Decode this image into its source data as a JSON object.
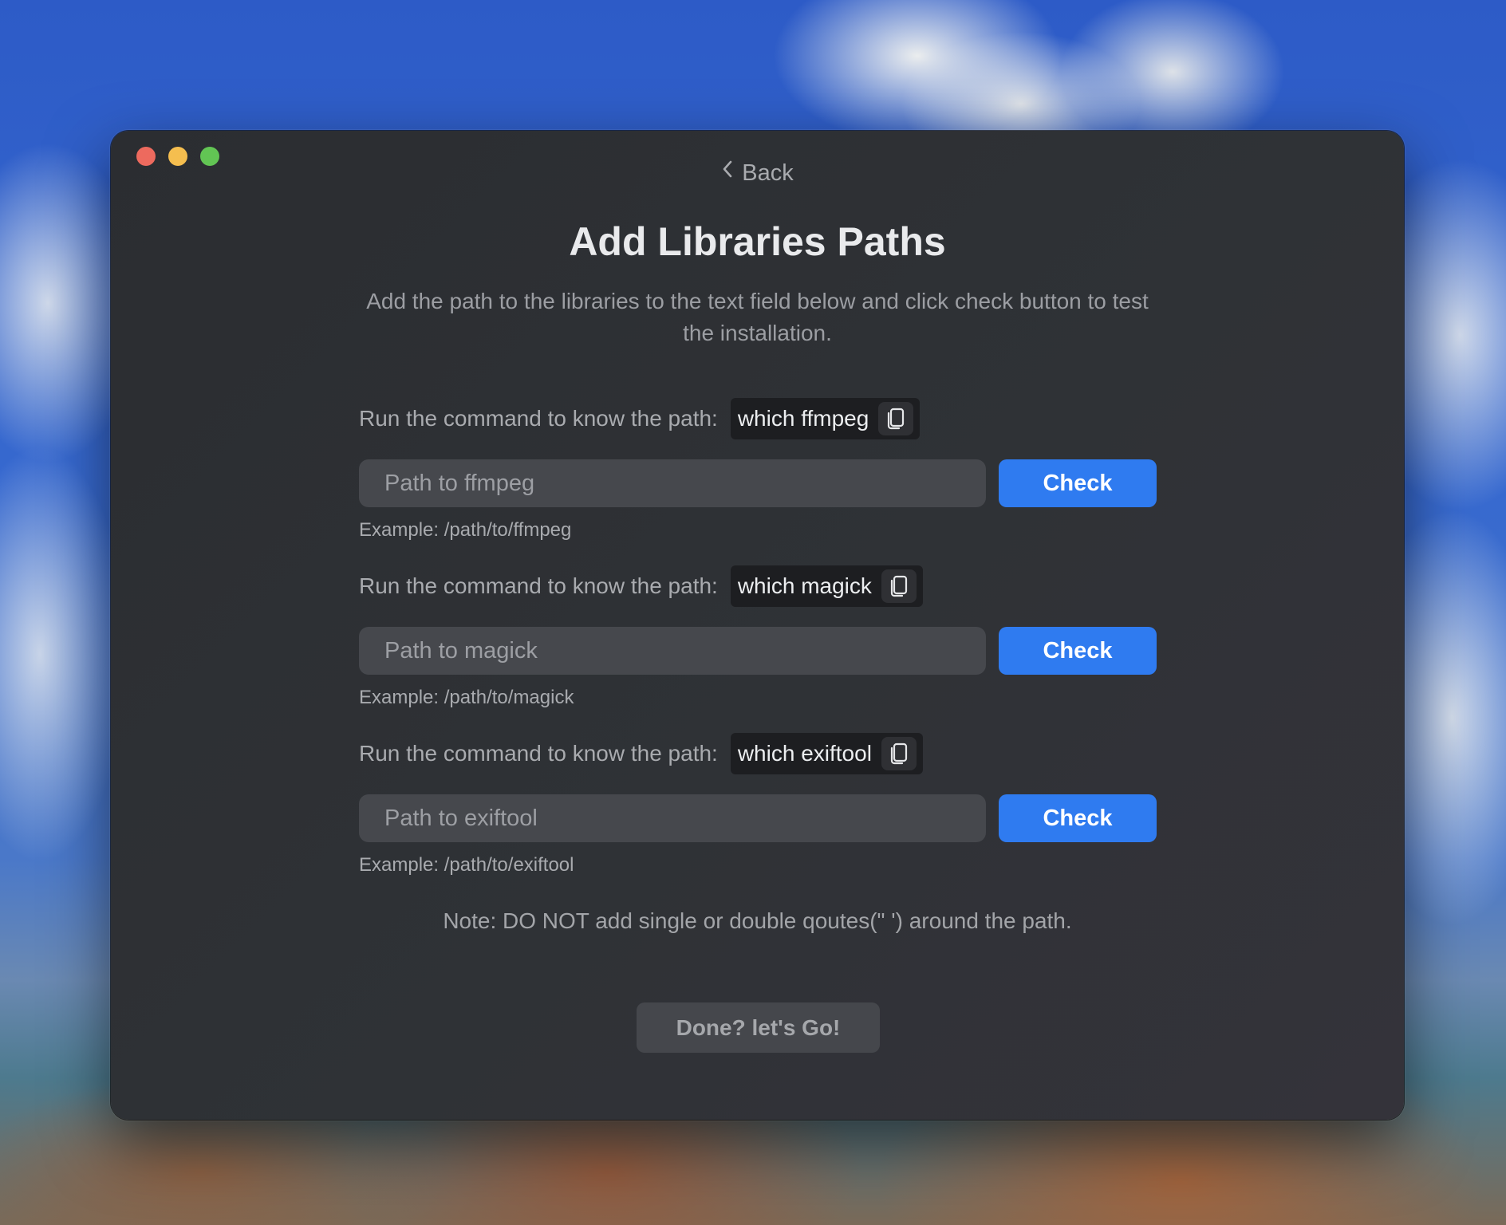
{
  "window": {
    "controls": [
      "close",
      "minimize",
      "maximize"
    ]
  },
  "nav": {
    "back_label": "Back"
  },
  "header": {
    "title": "Add Libraries Paths",
    "subtitle": "Add the path to the libraries to the text field below and click check button to test the installation."
  },
  "libraries": [
    {
      "command_label": "Run the command to know the path:",
      "command": "which ffmpeg",
      "input_value": "",
      "input_placeholder": "Path to ffmpeg",
      "check_label": "Check",
      "example": "Example: /path/to/ffmpeg"
    },
    {
      "command_label": "Run the command to know the path:",
      "command": "which magick",
      "input_value": "",
      "input_placeholder": "Path to magick",
      "check_label": "Check",
      "example": "Example: /path/to/magick"
    },
    {
      "command_label": "Run the command to know the path:",
      "command": "which exiftool",
      "input_value": "",
      "input_placeholder": "Path to exiftool",
      "check_label": "Check",
      "example": "Example: /path/to/exiftool"
    }
  ],
  "note": "Note: DO NOT add single or double qoutes(\" ') around the path.",
  "footer": {
    "done_label": "Done? let's Go!"
  },
  "colors": {
    "accent": "#2f7bf0",
    "window_bg": "#2f3236",
    "input_bg": "#46484d",
    "close": "#ed6a5e",
    "minimize": "#f5be4f",
    "maximize": "#62c554"
  },
  "icons": {
    "back": "chevron-left-icon",
    "copy": "copy-icon"
  }
}
